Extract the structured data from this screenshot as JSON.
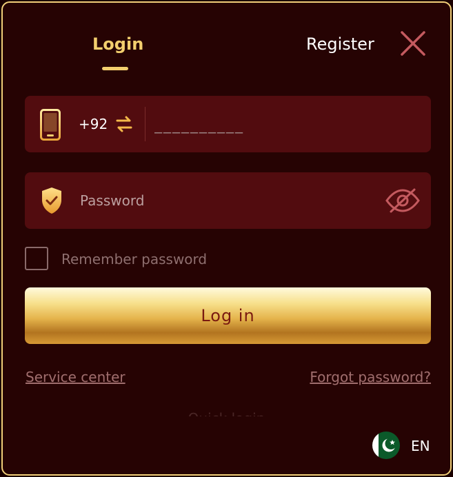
{
  "tabs": {
    "login_label": "Login",
    "register_label": "Register"
  },
  "phone": {
    "country_code": "+92",
    "placeholder": "__________"
  },
  "password": {
    "placeholder": "Password"
  },
  "remember": {
    "label": "Remember password",
    "checked": false
  },
  "actions": {
    "login_label": "Log in",
    "service_center": "Service center",
    "forgot_password": "Forgot password?",
    "quick_login": "Quick login"
  },
  "language": {
    "code": "EN",
    "flag": "pakistan-flag-icon"
  },
  "icons": {
    "close": "close-icon",
    "phone": "phone-icon",
    "swap": "swap-icon",
    "shield": "shield-check-icon",
    "eye": "eye-off-icon"
  },
  "colors": {
    "accent_gold": "#f3cf6e",
    "background": "#260303",
    "field_bg": "#520c0f",
    "border": "#f2d07a"
  }
}
